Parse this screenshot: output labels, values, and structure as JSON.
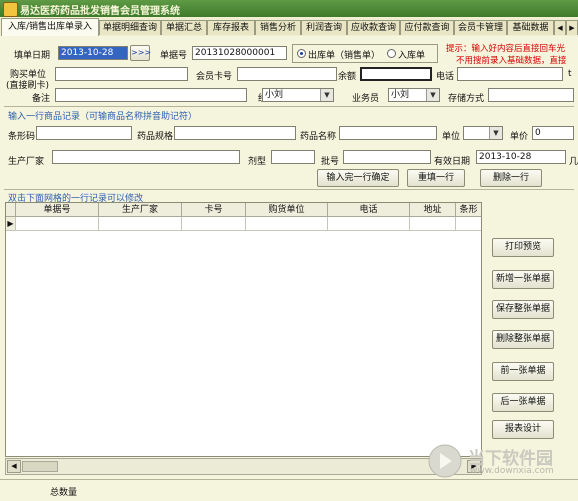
{
  "window": {
    "title": "易达医药药品批发销售会员管理系统"
  },
  "tabs": [
    {
      "label": "入库/销售出库单录入"
    },
    {
      "label": "单据明细查询"
    },
    {
      "label": "单据汇总"
    },
    {
      "label": "库存报表"
    },
    {
      "label": "销售分析"
    },
    {
      "label": "利润查询"
    },
    {
      "label": "应收款查询"
    },
    {
      "label": "应付款查询"
    },
    {
      "label": "会员卡管理"
    },
    {
      "label": "基础数据"
    }
  ],
  "header": {
    "date_label": "填单日期",
    "date_value": "2013-10-28",
    "next_button": ">>>",
    "docno_label": "单据号",
    "docno_value": "20131028000001",
    "radio_out_label": "出库单（销售单）",
    "radio_in_label": "入库单",
    "hint_line1": "提示：输入好内容后直接回车光",
    "hint_line2": "不用搜前录入基础数据，直接",
    "buyer_label_1": "购买单位",
    "buyer_label_2": "(直接刷卡)",
    "card_label": "会员卡号",
    "balance_label": "余额",
    "phone_label": "电话",
    "phone_cut_label": "t",
    "remark_label": "备注",
    "handler_label": "经手人",
    "handler_value": "小刘",
    "salesman_label": "业务员",
    "salesman_value": "小刘",
    "storage_label": "存储方式"
  },
  "entry": {
    "section_title": "输入一行商品记录（可输商品名称拼音助记符）",
    "barcode_label": "条形码",
    "spec_label": "药品规格",
    "name_label": "药品名称",
    "unit_label": "单位",
    "price_label": "单价",
    "price_value": "0",
    "maker_label": "生产厂家",
    "form_label": "剂型",
    "batch_label": "批号",
    "expiry_label": "有效日期",
    "expiry_value": "2013-10-28",
    "expiry_cut_label": "几",
    "confirm_button": "输入完一行确定",
    "refill_button": "重填一行",
    "delete_button": "删除一行"
  },
  "grid": {
    "hint": "双击下面网格的一行记录可以修改",
    "columns": [
      "单据号",
      "生产厂家",
      "卡号",
      "购货单位",
      "电话",
      "地址",
      "条形码"
    ],
    "row_marker": "▶"
  },
  "actions": [
    {
      "label": "打印预览"
    },
    {
      "label": "新增一张单据"
    },
    {
      "label": "保存整张单据"
    },
    {
      "label": "删除整张单据"
    },
    {
      "label": "前一张单据"
    },
    {
      "label": "后一张单据"
    },
    {
      "label": "报表设计"
    }
  ],
  "footer": {
    "total_label": "总数量"
  },
  "watermark": {
    "text": "当下软件园",
    "url": "www.downxia.com"
  },
  "colors": {
    "titlebar": "#4f8a38",
    "hint_red": "#d80000",
    "section_blue": "#2b5fb5",
    "selection": "#3565c2"
  }
}
